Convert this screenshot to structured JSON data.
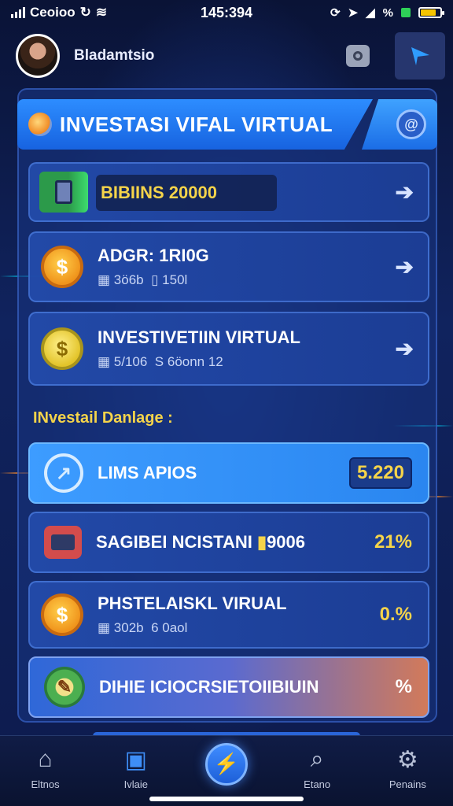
{
  "status_bar": {
    "carrier": "Ceoioo",
    "time": "145:394",
    "battery_icon": "battery-icon",
    "percent_icon": "%"
  },
  "header": {
    "username": "Bladamtsio"
  },
  "banner": {
    "title": "INVESTASI VIFAL VIRTUAL"
  },
  "cards_top": [
    {
      "title": "BIBIINS 20000"
    },
    {
      "title": "ADGR: 1RI0G",
      "sub_a": "3ö6b",
      "sub_b": "150l"
    },
    {
      "title": "INVESTIVETIIN VIRTUAL",
      "sub_a": "5/106",
      "sub_b": "S 6öonn 12"
    }
  ],
  "section": {
    "title": "INvestail Danlage :"
  },
  "cards_bottom": [
    {
      "title": "LIMS APIOS",
      "value": "5.220"
    },
    {
      "title": "SAGIBEI NCISTANI",
      "extra": "9006",
      "value": "21%"
    },
    {
      "title": "PHSTELAISKL VIRUAL",
      "sub_a": "302b",
      "sub_b": "6 0aol",
      "value": "0.%"
    },
    {
      "title": "DIHIE ICIOCRSIETOIIBIUIN",
      "value": "%"
    }
  ],
  "nav": [
    {
      "label": "Eltnos",
      "icon": "home-icon"
    },
    {
      "label": "Ivlaie",
      "icon": "map-icon"
    },
    {
      "label": "",
      "icon": "compass-icon"
    },
    {
      "label": "Etano",
      "icon": "search-icon"
    },
    {
      "label": "Penains",
      "icon": "gear-icon"
    }
  ],
  "colors": {
    "accent": "#2d8dff",
    "highlight": "#f5d44a",
    "background": "#0b1640"
  }
}
